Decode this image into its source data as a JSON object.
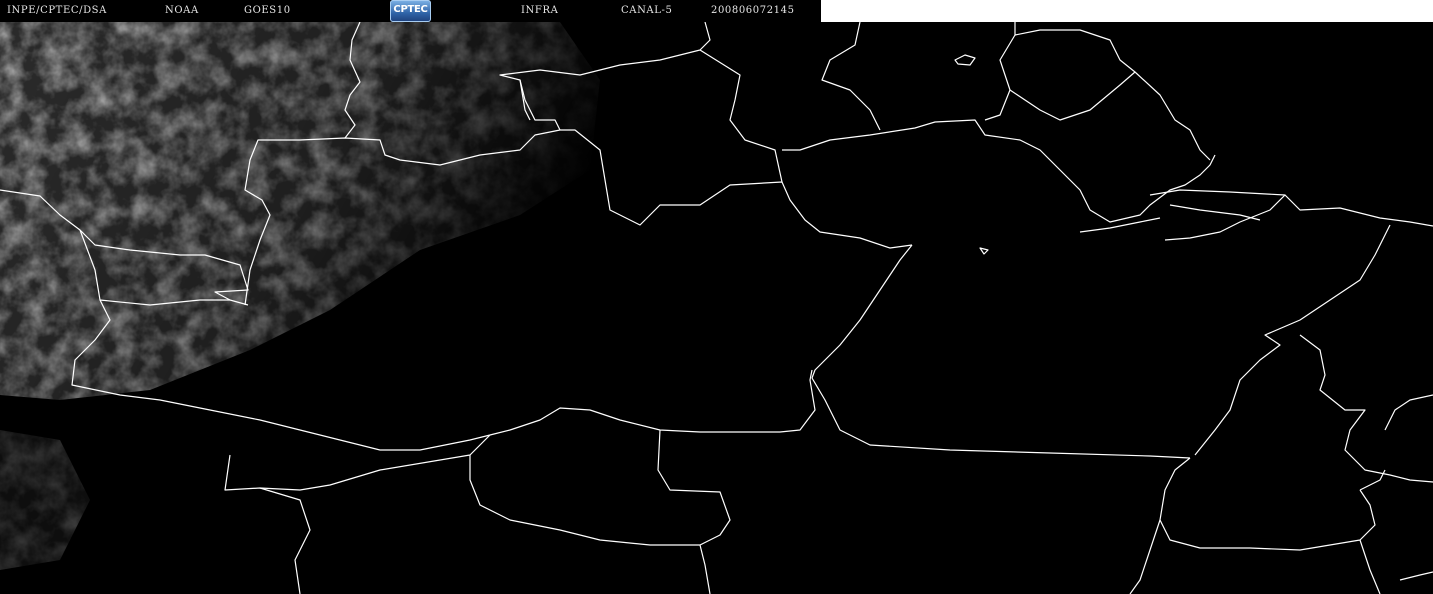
{
  "header": {
    "source": "INPE/CPTEC/DSA",
    "agency": "NOAA",
    "satellite": "GOES10",
    "logo_text": "CPTEC",
    "band": "INFRA",
    "channel": "CANAL-5",
    "timestamp": "200806072145"
  },
  "map": {
    "boundary_color": "#ffffff",
    "cloud_color": "#bcbcbc",
    "background_color": "#000000"
  }
}
